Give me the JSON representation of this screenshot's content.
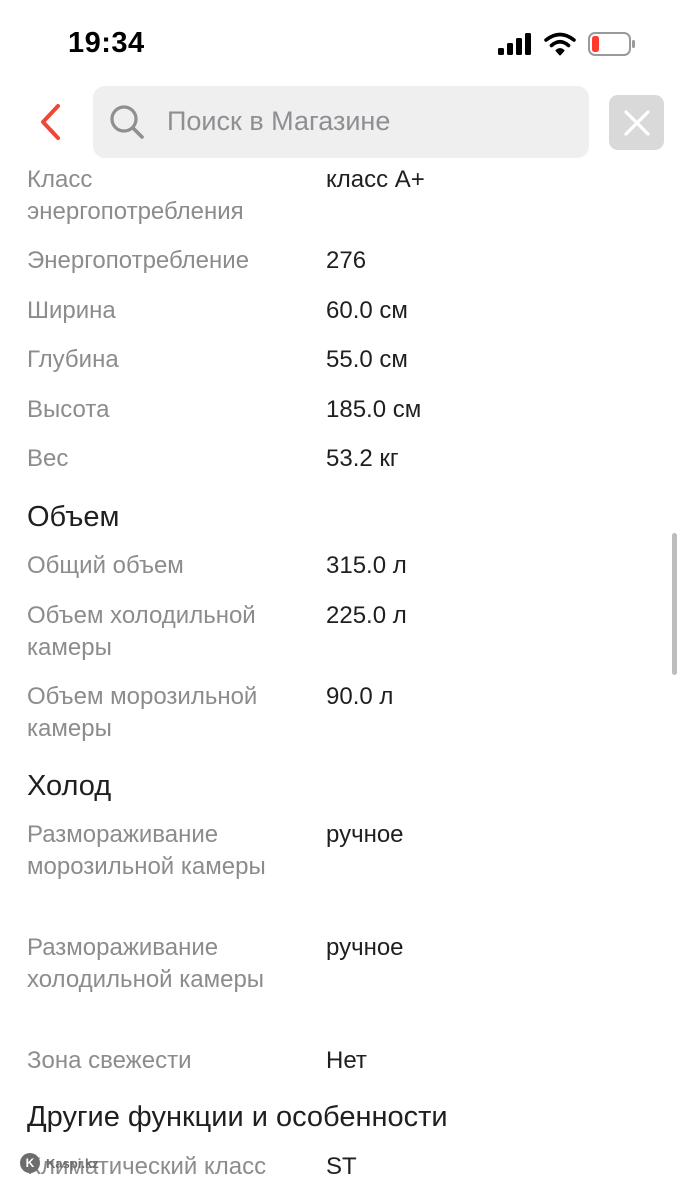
{
  "status_bar": {
    "time": "19:34"
  },
  "search": {
    "placeholder": "Поиск в Магазине"
  },
  "rows_top": [
    {
      "label": "Класс энергопотребления",
      "value": "класс А+"
    },
    {
      "label": "Энергопотребление",
      "value": "276"
    },
    {
      "label": "Ширина",
      "value": "60.0 см"
    },
    {
      "label": "Глубина",
      "value": "55.0 см"
    },
    {
      "label": "Высота",
      "value": "185.0 см"
    },
    {
      "label": "Вес",
      "value": "53.2 кг"
    }
  ],
  "section_volume": {
    "title": "Объем",
    "rows": [
      {
        "label": "Общий объем",
        "value": "315.0 л"
      },
      {
        "label": "Объем холодильной камеры",
        "value": "225.0 л"
      },
      {
        "label": "Объем морозильной камеры",
        "value": "90.0 л"
      }
    ]
  },
  "section_cold": {
    "title": "Холод",
    "rows": [
      {
        "label": "Размораживание морозильной камеры",
        "value": "ручное"
      },
      {
        "label": "Размораживание холодильной камеры",
        "value": "ручное"
      },
      {
        "label": "Зона свежести",
        "value": "Нет"
      }
    ]
  },
  "section_other": {
    "title": "Другие функции и особенности",
    "rows": [
      {
        "label": "Климатический класс",
        "value": "ST"
      }
    ]
  },
  "watermark": {
    "text": "Kaspi.kz"
  },
  "colors": {
    "accent": "#f14635",
    "label_gray": "#8c8c8c",
    "value_dark": "#1f1f1f"
  },
  "icons": [
    "back-arrow-icon",
    "search-icon",
    "close-icon",
    "signal-icon",
    "wifi-icon",
    "battery-icon",
    "kaspi-logo-icon"
  ]
}
